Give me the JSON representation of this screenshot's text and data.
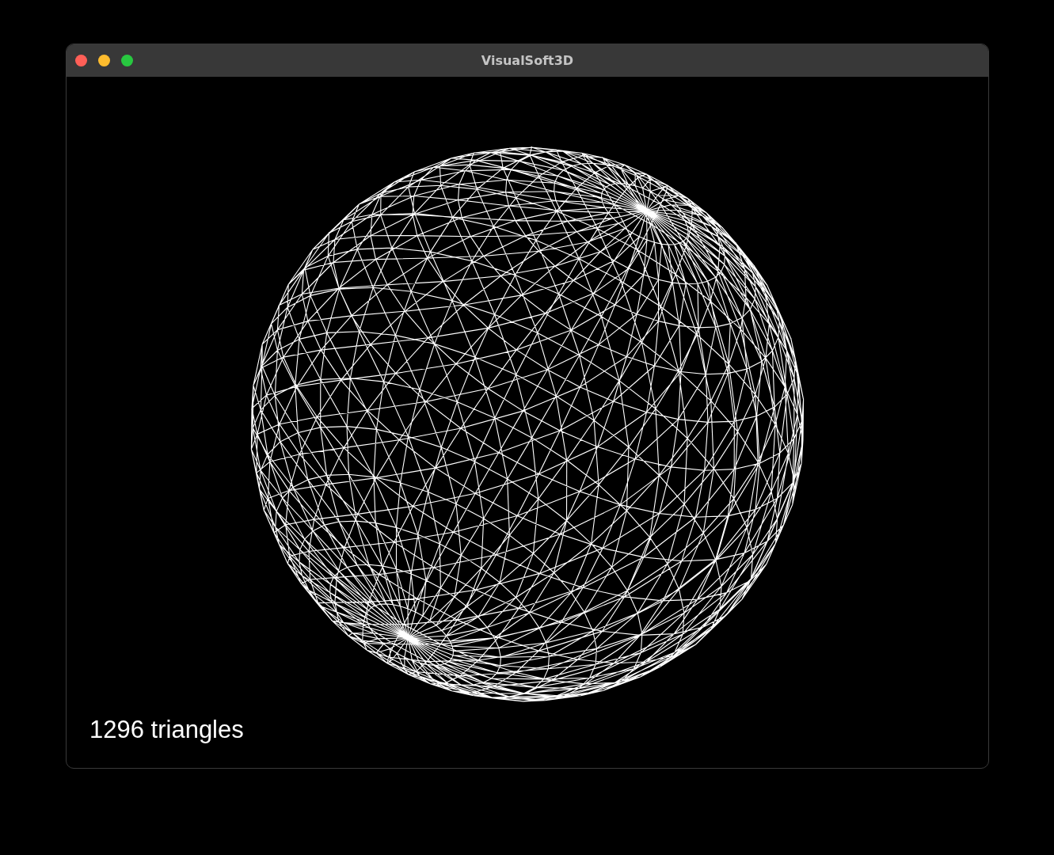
{
  "window": {
    "title": "VisualSoft3D"
  },
  "overlay": {
    "triangle_count": "1296 triangles"
  }
}
